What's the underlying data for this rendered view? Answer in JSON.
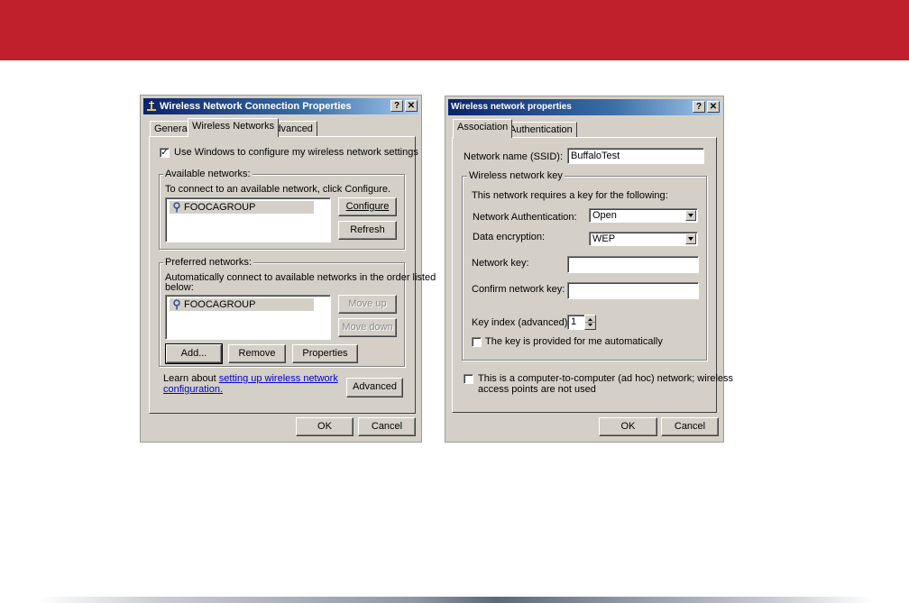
{
  "left_dialog": {
    "title": "Wireless Network Connection Properties",
    "help_glyph": "?",
    "close_glyph": "✕",
    "tabs": [
      "General",
      "Wireless Networks",
      "Advanced"
    ],
    "use_windows_checkbox": {
      "checked": true,
      "label": "Use Windows to configure my wireless network settings"
    },
    "available": {
      "group_label": "Available networks:",
      "instruction": "To connect to an available network, click Configure.",
      "items": [
        "FOOCAGROUP"
      ],
      "configure_button": "Configure",
      "refresh_button": "Refresh"
    },
    "preferred": {
      "group_label": "Preferred networks:",
      "instruction_line1": "Automatically connect to available networks in the order listed",
      "instruction_line2": "below:",
      "items": [
        "FOOCAGROUP"
      ],
      "move_up_button": "Move up",
      "move_down_button": "Move down",
      "add_button": "Add...",
      "remove_button": "Remove",
      "properties_button": "Properties"
    },
    "learn_prefix": "Learn about ",
    "learn_link_line1": "setting up wireless network",
    "learn_link_line2": "configuration.",
    "advanced_button": "Advanced",
    "ok_button": "OK",
    "cancel_button": "Cancel"
  },
  "right_dialog": {
    "title": "Wireless network properties",
    "help_glyph": "?",
    "close_glyph": "✕",
    "tabs": [
      "Association",
      "Authentication"
    ],
    "ssid_label": "Network name (SSID):",
    "ssid_value": "BuffaloTest",
    "key_group_label": "Wireless network key",
    "key_required_text": "This network requires a key for the following:",
    "auth_label": "Network Authentication:",
    "auth_value": "Open",
    "encryption_label": "Data encryption:",
    "encryption_value": "WEP",
    "network_key_label": "Network key:",
    "network_key_value": "",
    "confirm_key_label": "Confirm network key:",
    "confirm_key_value": "",
    "key_index_label": "Key index (advanced):",
    "key_index_value": "1",
    "auto_key_checkbox": {
      "checked": false,
      "label": "The key is provided for me automatically"
    },
    "adhoc_checkbox": {
      "checked": false,
      "label_line1": "This is a computer-to-computer (ad hoc) network; wireless",
      "label_line2": "access points are not used"
    },
    "ok_button": "OK",
    "cancel_button": "Cancel"
  }
}
